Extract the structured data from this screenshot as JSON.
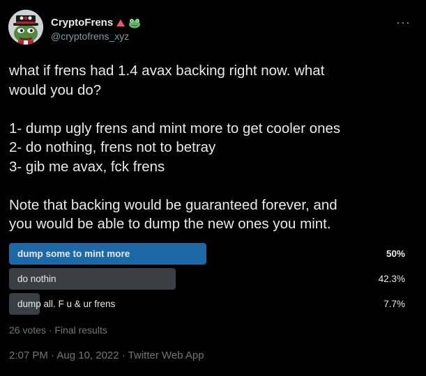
{
  "author": {
    "display_name": "CryptoFrens",
    "handle": "@cryptofrens_xyz",
    "emoji_badges": [
      "red-triangle-icon",
      "frog-icon"
    ]
  },
  "tweet": {
    "text": "what if frens had 1.4 avax backing right now. what\nwould you do?\n\n1- dump ugly frens and mint more to get cooler ones\n2- do nothing, frens not to betray\n3- gib me avax, fck frens\n\nNote that backing would be guaranteed forever, and\nyou would be able to dump the new ones you mint."
  },
  "poll": {
    "options": [
      {
        "label": "dump some to mint more",
        "percent": "50%",
        "share": 0.5,
        "winner": true
      },
      {
        "label": "do nothin",
        "percent": "42.3%",
        "share": 0.423,
        "winner": false
      },
      {
        "label": "dump all. F u & ur frens",
        "percent": "7.7%",
        "share": 0.077,
        "winner": false
      }
    ],
    "votes": "26 votes · Final results"
  },
  "meta": {
    "timestamp": "2:07 PM · Aug 10, 2022 · Twitter Web App"
  },
  "colors": {
    "winner_bar": "#1d69a8",
    "other_bar": "#3a3f44",
    "muted": "#71767b"
  }
}
